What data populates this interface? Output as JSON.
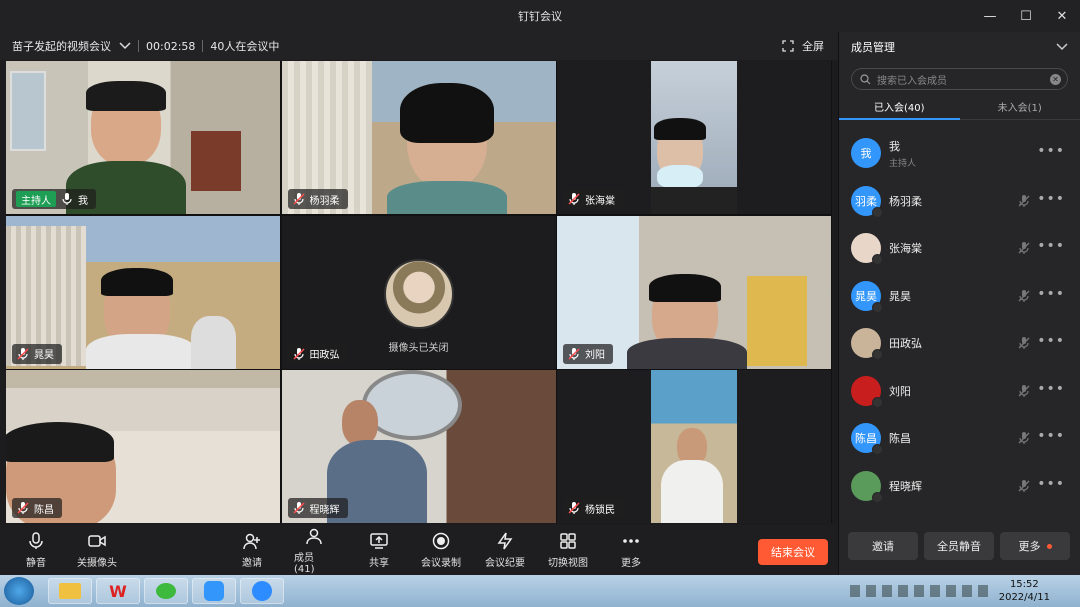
{
  "window": {
    "title": "钉钉会议"
  },
  "info": {
    "meeting_name": "苗子发起的视频会议",
    "duration": "00:02:58",
    "count": "40人在会议中",
    "fullscreen": "全屏"
  },
  "tiles": [
    {
      "name": "我",
      "host": "主持人"
    },
    {
      "name": "杨羽柔"
    },
    {
      "name": "张海棠"
    },
    {
      "name": "晁昊"
    },
    {
      "name": "田政弘",
      "camera_off": "摄像头已关闭"
    },
    {
      "name": "刘阳"
    },
    {
      "name": "陈昌"
    },
    {
      "name": "程晓辉"
    },
    {
      "name": "杨锁民"
    }
  ],
  "toolbar": {
    "mute": "静音",
    "camera": "关摄像头",
    "invite": "邀请",
    "members": "成员(41)",
    "share": "共享",
    "record": "会议录制",
    "minutes": "会议纪要",
    "view": "切换视图",
    "more": "更多",
    "end": "结束会议"
  },
  "panel": {
    "title": "成员管理",
    "search_placeholder": "搜索已入会成员",
    "tab_joined": "已入会(40)",
    "tab_not_joined": "未入会(1)",
    "members": [
      {
        "name": "我",
        "role": "主持人",
        "avatar": "我",
        "color": "#3296fa"
      },
      {
        "name": "杨羽柔",
        "avatar": "羽柔",
        "color": "#3296fa"
      },
      {
        "name": "张海棠",
        "avatar": "",
        "color": "#e8d6c8"
      },
      {
        "name": "晁昊",
        "avatar": "晁昊",
        "color": "#3296fa"
      },
      {
        "name": "田政弘",
        "avatar": "",
        "color": "#c9b49a"
      },
      {
        "name": "刘阳",
        "avatar": "",
        "color": "#c81e1e"
      },
      {
        "name": "陈昌",
        "avatar": "陈昌",
        "color": "#3296fa"
      },
      {
        "name": "程晓辉",
        "avatar": "",
        "color": "#5a9a5a"
      }
    ],
    "invite": "邀请",
    "mute_all": "全员静音",
    "more": "更多"
  },
  "taskbar": {
    "time": "15:52",
    "date": "2022/4/11"
  }
}
